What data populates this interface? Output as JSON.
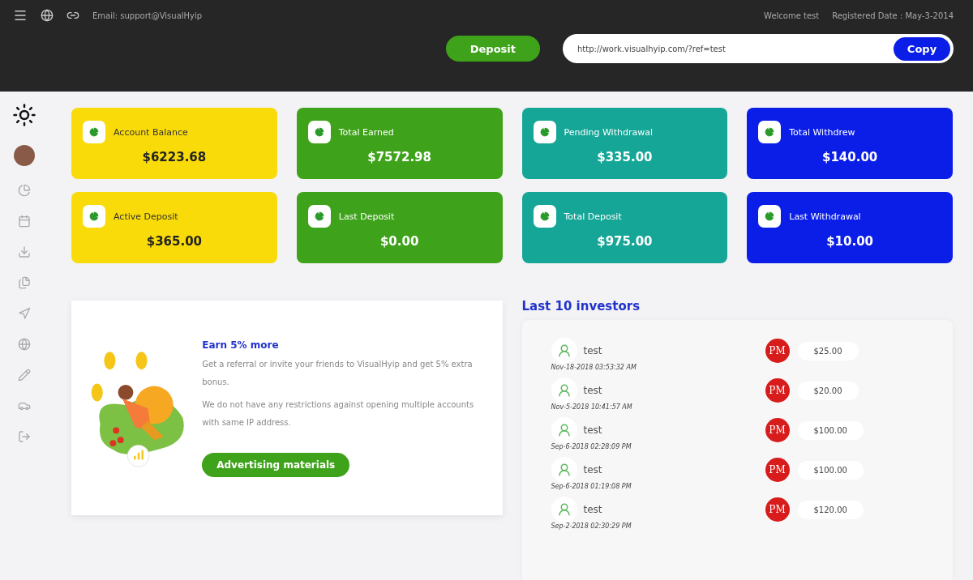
{
  "header": {
    "email": "Email: support@VisualHyip",
    "welcome": "Welcome test",
    "registered": "Registered Date : May-3-2014",
    "deposit_button": "Deposit",
    "referral_link": "http://work.visualhyip.com/?ref=test",
    "copy_button": "Copy"
  },
  "stats": [
    {
      "label": "Account Balance",
      "value": "$6223.68",
      "color": "#fadb0a"
    },
    {
      "label": "Total Earned",
      "value": "$7572.98",
      "color": "#3ea31a"
    },
    {
      "label": "Pending Withdrawal",
      "value": "$335.00",
      "color": "#16a697"
    },
    {
      "label": "Total Withdrew",
      "value": "$140.00",
      "color": "#0a1ee8"
    },
    {
      "label": "Active Deposit",
      "value": "$365.00",
      "color": "#fadb0a"
    },
    {
      "label": "Last Deposit",
      "value": "$0.00",
      "color": "#3ea31a"
    },
    {
      "label": "Total Deposit",
      "value": "$975.00",
      "color": "#16a697"
    },
    {
      "label": "Last Withdrawal",
      "value": "$10.00",
      "color": "#0a1ee8"
    }
  ],
  "promo": {
    "title": "Earn 5% more",
    "lines": [
      "Get a referral or invite your friends to VisualHyip and get 5% extra bonus.",
      "We do not have any restrictions against opening multiple accounts with same IP address."
    ],
    "button": "Advertising materials"
  },
  "investors": {
    "title": "Last 10 investors",
    "rows": [
      {
        "name": "test",
        "date": "Nov-18-2018 03:53:32 AM",
        "processor": "PM",
        "amount": "$25.00"
      },
      {
        "name": "test",
        "date": "Nov-5-2018 10:41:57 AM",
        "processor": "PM",
        "amount": "$20.00"
      },
      {
        "name": "test",
        "date": "Sep-6-2018 02:28:09 PM",
        "processor": "PM",
        "amount": "$100.00"
      },
      {
        "name": "test",
        "date": "Sep-6-2018 01:19:08 PM",
        "processor": "PM",
        "amount": "$100.00"
      },
      {
        "name": "test",
        "date": "Sep-2-2018 02:30:29 PM",
        "processor": "PM",
        "amount": "$120.00"
      }
    ]
  }
}
